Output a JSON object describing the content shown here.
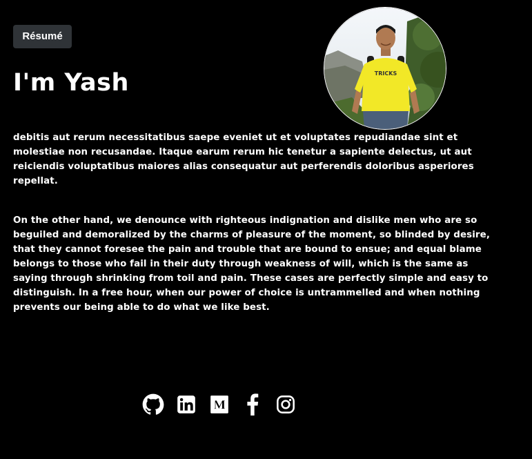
{
  "header": {
    "resume_label": "Résumé",
    "title": "I'm Yash"
  },
  "avatar": {
    "shirt_text": "TRICKS"
  },
  "bio": {
    "paragraph_1": "debitis aut rerum necessitatibus saepe eveniet ut et voluptates repudiandae sint et molestiae non recusandae. Itaque earum rerum hic tenetur a sapiente delectus, ut aut reiciendis voluptatibus maiores alias consequatur aut perferendis doloribus asperiores repellat.",
    "paragraph_2": "On the other hand, we denounce with righteous indignation and dislike men who are so beguiled and demoralized by the charms of pleasure of the moment, so blinded by desire, that they cannot foresee the pain and trouble that are bound to ensue; and equal blame belongs to those who fail in their duty through weakness of will, which is the same as saying through shrinking from toil and pain. These cases are perfectly simple and easy to distinguish. In a free hour, when our power of choice is untrammelled and when nothing prevents our being able to do what we like best."
  },
  "social": {
    "icons": [
      "github-icon",
      "linkedin-icon",
      "medium-icon",
      "facebook-icon",
      "instagram-icon"
    ]
  },
  "colors": {
    "background": "#000000",
    "text": "#ffffff",
    "button_bg": "#2f3337",
    "shirt": "#f2e827"
  }
}
